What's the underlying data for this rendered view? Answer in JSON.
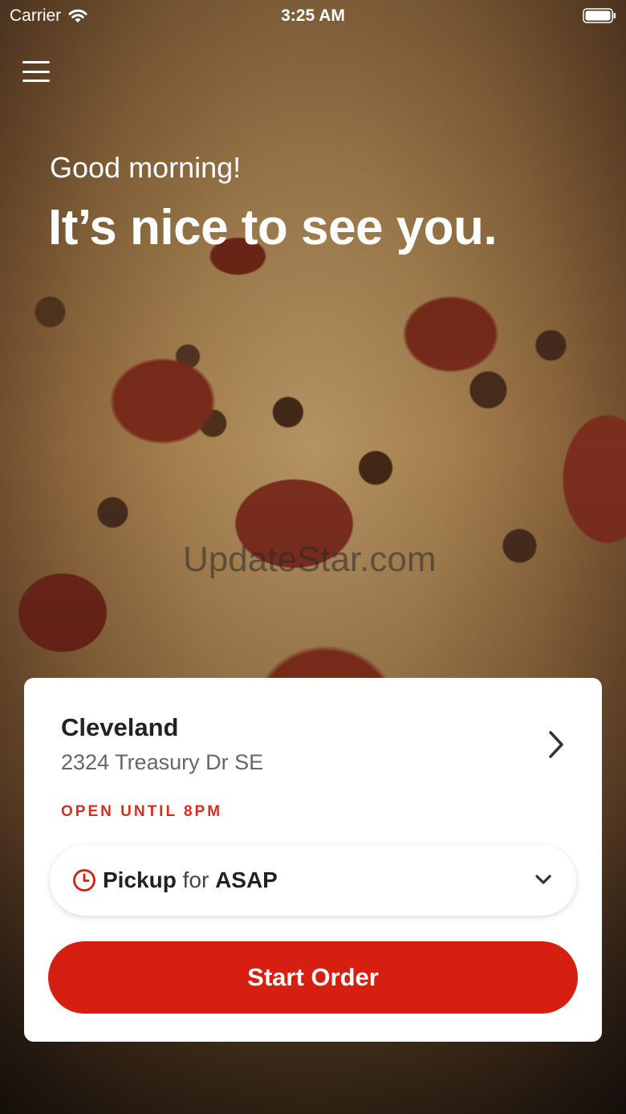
{
  "status_bar": {
    "carrier": "Carrier",
    "time": "3:25 AM"
  },
  "hero": {
    "greeting": "Good morning!",
    "headline": "It’s nice to see you.",
    "watermark": "UpdateStar.com"
  },
  "location": {
    "name": "Cleveland",
    "address": "2324 Treasury Dr SE",
    "status": "OPEN UNTIL 8PM"
  },
  "order_mode": {
    "mode": "Pickup",
    "connector": "for",
    "time": "ASAP"
  },
  "actions": {
    "start_order": "Start Order"
  },
  "colors": {
    "accent": "#d61f10",
    "status_text": "#d62d1d"
  },
  "icons": [
    "wifi-icon",
    "battery-icon",
    "hamburger-menu-icon",
    "chevron-right-icon",
    "clock-icon",
    "chevron-down-icon"
  ]
}
